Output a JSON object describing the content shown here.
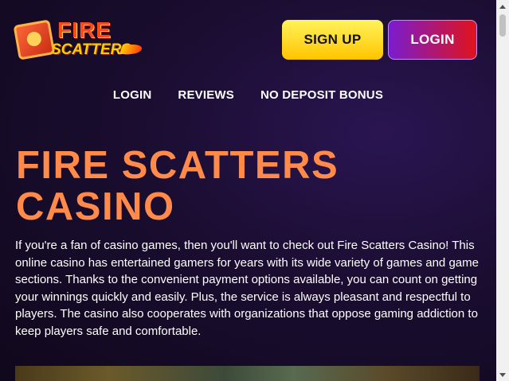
{
  "logo": {
    "line1": "FIRE",
    "line2": "SCATTERS"
  },
  "header": {
    "signup_label": "SIGN UP",
    "login_label": "LOGIN"
  },
  "nav": {
    "items": [
      "LOGIN",
      "REVIEWS",
      "NO DEPOSIT BONUS"
    ]
  },
  "main": {
    "title": "FIRE SCATTERS CASINO",
    "intro": "If you're a fan of casino games, then you'll want to check out Fire Scatters Casino! This online casino has entertained gamers for years with its wide variety of games and game sections. Thanks to the convenient payment options available, you can count on getting your winnings quickly and easily. Plus, the service is always pleasant and respectful to players. The casino also cooperates with organizations that oppose gaming addiction to keep players safe and comfortable."
  },
  "colors": {
    "title": "#ff8a4a",
    "signup_bg": "#ffd400",
    "login_bg_start": "#7a1ccf",
    "login_bg_end": "#e0131b"
  }
}
